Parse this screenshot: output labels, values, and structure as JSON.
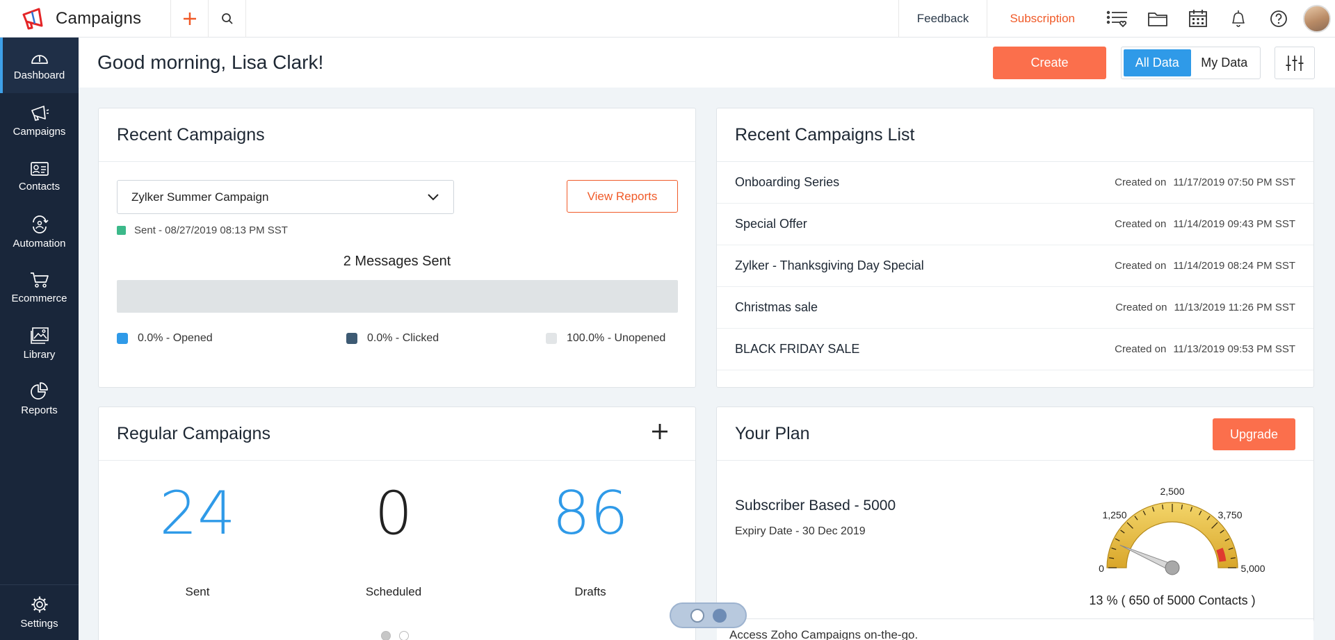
{
  "app": {
    "title": "Campaigns"
  },
  "topbar": {
    "feedback": "Feedback",
    "subscription": "Subscription"
  },
  "sidebar": {
    "items": [
      {
        "label": "Dashboard",
        "icon": "speedometer-icon",
        "active": true
      },
      {
        "label": "Campaigns",
        "icon": "megaphone-icon"
      },
      {
        "label": "Contacts",
        "icon": "contact-card-icon"
      },
      {
        "label": "Automation",
        "icon": "automation-icon"
      },
      {
        "label": "Ecommerce",
        "icon": "cart-icon"
      },
      {
        "label": "Library",
        "icon": "image-library-icon"
      },
      {
        "label": "Reports",
        "icon": "pie-chart-icon"
      }
    ],
    "settings": "Settings"
  },
  "header": {
    "greeting": "Good morning, Lisa Clark!",
    "create": "Create",
    "all_data": "All Data",
    "my_data": "My Data"
  },
  "recent": {
    "title": "Recent Campaigns",
    "selected_campaign": "Zylker Summer Campaign",
    "view_reports": "View Reports",
    "sent_status": "Sent - 08/27/2019 08:13 PM SST",
    "messages_sent": "2 Messages Sent",
    "legend": [
      {
        "label": "0.0% - Opened",
        "color": "#2f9ae8"
      },
      {
        "label": "0.0% - Clicked",
        "color": "#3d5a73"
      },
      {
        "label": "100.0% - Unopened",
        "color": "#e2e5e7"
      }
    ],
    "opened_pct": 0,
    "clicked_pct": 0,
    "unopened_pct": 100
  },
  "list": {
    "title": "Recent Campaigns List",
    "created_prefix": "Created on",
    "rows": [
      {
        "name": "Onboarding Series",
        "date": "11/17/2019 07:50 PM SST"
      },
      {
        "name": "Special Offer",
        "date": "11/14/2019 09:43 PM SST"
      },
      {
        "name": "Zylker - Thanksgiving Day Special",
        "date": "11/14/2019 08:24 PM SST"
      },
      {
        "name": "Christmas sale",
        "date": "11/13/2019 11:26 PM SST"
      },
      {
        "name": "BLACK FRIDAY SALE",
        "date": "11/13/2019 09:53 PM SST"
      }
    ]
  },
  "regular": {
    "title": "Regular Campaigns",
    "stats": [
      {
        "value": "24",
        "label": "Sent"
      },
      {
        "value": "0",
        "label": "Scheduled"
      },
      {
        "value": "86",
        "label": "Drafts"
      }
    ]
  },
  "plan": {
    "title": "Your Plan",
    "upgrade": "Upgrade",
    "name": "Subscriber Based - 5000",
    "expiry": "Expiry Date - 30 Dec 2019",
    "gauge_labels": [
      "0",
      "1,250",
      "2,500",
      "3,750",
      "5,000"
    ],
    "used": 650,
    "limit": 5000,
    "caption": "13 % ( 650 of 5000 Contacts )"
  },
  "footer": {
    "mobile_promo": "Access Zoho Campaigns on-the-go."
  }
}
